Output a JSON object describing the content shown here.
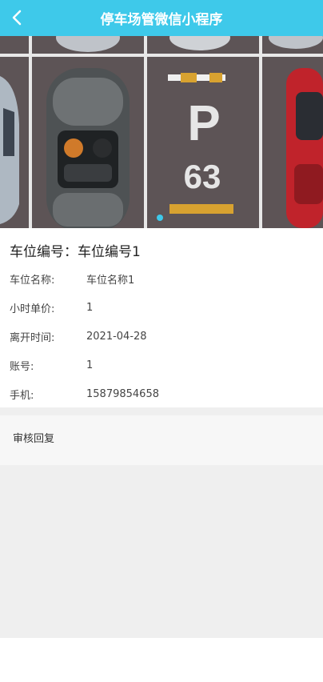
{
  "header": {
    "title": "停车场管微信小程序"
  },
  "banner": {
    "slot_number_text": "63",
    "p_text": "P"
  },
  "details": {
    "title": "车位编号：车位编号1",
    "rows": [
      {
        "label": "车位名称:",
        "value": "车位名称1"
      },
      {
        "label": "小时单价:",
        "value": "1"
      },
      {
        "label": "离开时间:",
        "value": "2021-04-28"
      },
      {
        "label": "账号:",
        "value": "1"
      },
      {
        "label": "手机:",
        "value": "15879854658"
      }
    ]
  },
  "reply": {
    "label": "审核回复"
  },
  "colors": {
    "accent": "#3ec9ea",
    "asphalt": "#5d5456"
  }
}
